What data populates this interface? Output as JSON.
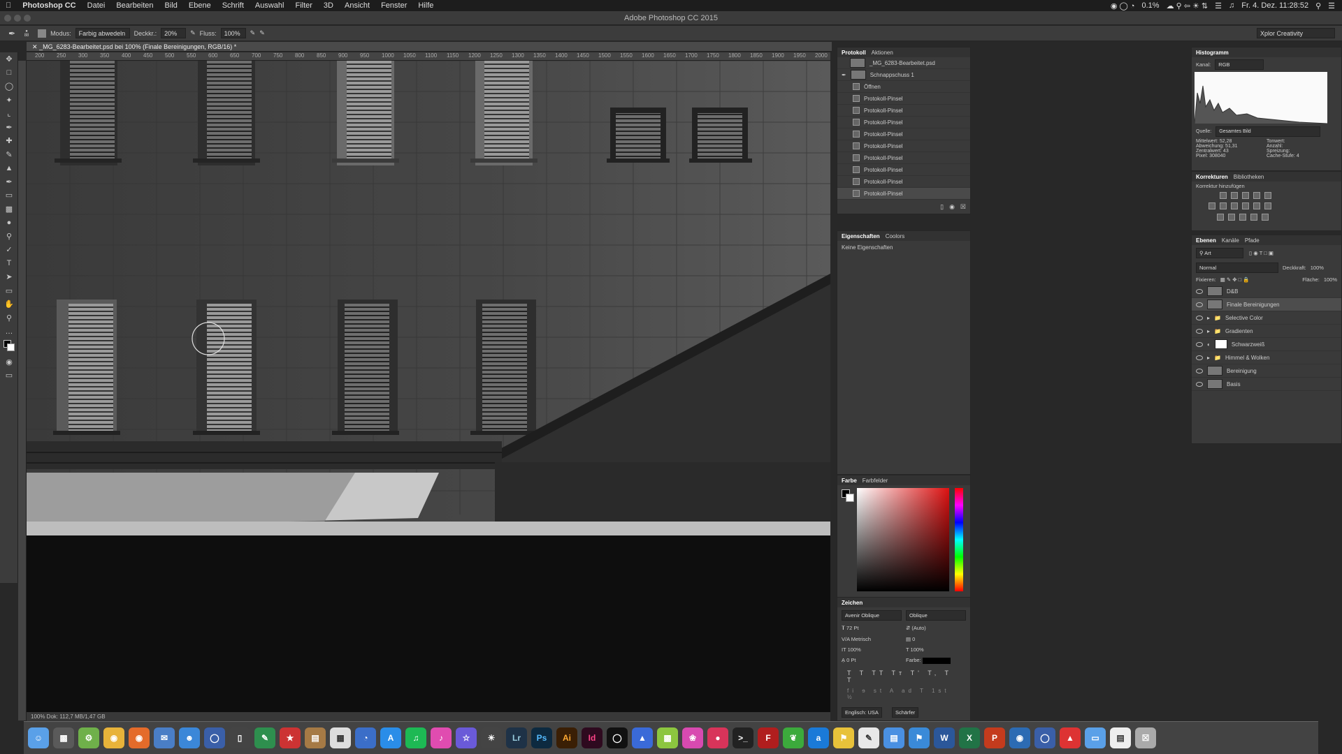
{
  "menubar": {
    "app_name": "Photoshop CC",
    "items": [
      "Datei",
      "Bearbeiten",
      "Bild",
      "Ebene",
      "Schrift",
      "Auswahl",
      "Filter",
      "3D",
      "Ansicht",
      "Fenster",
      "Hilfe"
    ],
    "battery": "0.1%",
    "datetime": "Fr. 4. Dez.  11:28:52"
  },
  "window": {
    "title": "Adobe Photoshop CC 2015",
    "workspace": "Xplor Creativity"
  },
  "options": {
    "mode_label": "Modus:",
    "mode_value": "Farbig abwedeln",
    "opacity_label": "Deckkr.:",
    "opacity_value": "20%",
    "flow_label": "Fluss:",
    "flow_value": "100%",
    "brush_size": "88"
  },
  "document": {
    "tab_title": "_MG_6283-Bearbeitet.psd bei 100% (Finale Bereinigungen, RGB/16) *",
    "status": "100%       Dok: 112,7 MB/1,47 GB",
    "ruler_ticks": [
      "200",
      "250",
      "300",
      "350",
      "400",
      "450",
      "500",
      "550",
      "600",
      "650",
      "700",
      "750",
      "800",
      "850",
      "900",
      "950",
      "1000",
      "1050",
      "1100",
      "1150",
      "1200",
      "1250",
      "1300",
      "1350",
      "1400",
      "1450",
      "1500",
      "1550",
      "1600",
      "1650",
      "1700",
      "1750",
      "1800",
      "1850",
      "1900",
      "1950",
      "2000"
    ]
  },
  "protokoll": {
    "tabs": [
      "Protokoll",
      "Aktionen"
    ],
    "snapshot_file": "_MG_6283-Bearbeitet.psd",
    "snapshot": "Schnappschuss 1",
    "steps": [
      "Öffnen",
      "Protokoll-Pinsel",
      "Protokoll-Pinsel",
      "Protokoll-Pinsel",
      "Protokoll-Pinsel",
      "Protokoll-Pinsel",
      "Protokoll-Pinsel",
      "Protokoll-Pinsel",
      "Protokoll-Pinsel",
      "Protokoll-Pinsel"
    ]
  },
  "histogram": {
    "title": "Histogramm",
    "channel_label": "Kanal:",
    "channel_value": "RGB",
    "source_label": "Quelle:",
    "source_value": "Gesamtes Bild",
    "stats_left": [
      [
        "Mittelwert:",
        "52,28"
      ],
      [
        "Abweichung:",
        "51,31"
      ],
      [
        "Zentralwert:",
        "43"
      ],
      [
        "Pixel:",
        "308040"
      ]
    ],
    "stats_right": [
      [
        "Tonwert:",
        ""
      ],
      [
        "Anzahl:",
        ""
      ],
      [
        "Spreizung:",
        ""
      ],
      [
        "Cache-Stufe:",
        "4"
      ]
    ]
  },
  "korrekturen": {
    "tabs": [
      "Korrekturen",
      "Bibliotheken"
    ],
    "add_label": "Korrektur hinzufügen"
  },
  "eigenschaften": {
    "tabs": [
      "Eigenschaften",
      "Coolors"
    ],
    "empty": "Keine Eigenschaften"
  },
  "ebenen": {
    "tabs": [
      "Ebenen",
      "Kanäle",
      "Pfade"
    ],
    "filter": "Art",
    "blend_mode": "Normal",
    "opacity_label": "Deckkraft:",
    "opacity_value": "100%",
    "lock_label": "Fixieren:",
    "fill_label": "Fläche:",
    "fill_value": "100%",
    "layers": [
      {
        "name": "D&B",
        "type": "layer"
      },
      {
        "name": "Finale Bereinigungen",
        "type": "layer",
        "selected": true
      },
      {
        "name": "Selective Color",
        "type": "group"
      },
      {
        "name": "Gradienten",
        "type": "group"
      },
      {
        "name": "Schwarzweiß",
        "type": "adjustment"
      },
      {
        "name": "Himmel & Wolken",
        "type": "group"
      },
      {
        "name": "Bereinigung",
        "type": "layer"
      },
      {
        "name": "Basis",
        "type": "layer"
      }
    ]
  },
  "farbe": {
    "tabs": [
      "Farbe",
      "Farbfelder"
    ]
  },
  "zeichen": {
    "title": "Zeichen",
    "font": "Avenir Oblique",
    "style": "Oblique",
    "size": "72 Pt",
    "leading": "(Auto)",
    "kerning": "Metrisch",
    "tracking": "0",
    "vscale": "100%",
    "hscale": "100%",
    "baseline": "0 Pt",
    "color_label": "Farbe:",
    "language": "Englisch: USA",
    "aa": "Schärfer"
  },
  "colors": {
    "accent": "#3b7bd0",
    "panel": "#3a3a3a",
    "bg": "#282828"
  }
}
